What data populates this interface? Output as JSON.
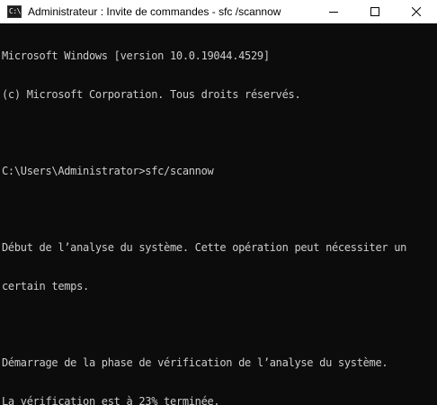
{
  "window": {
    "title": "Administrateur : Invite de commandes - sfc /scannow",
    "icon": "cmd-icon",
    "icon_glyph": "C:\\.",
    "controls": {
      "minimize": "minimize-icon",
      "maximize": "maximize-icon",
      "close": "close-icon"
    }
  },
  "console": {
    "lines": [
      "Microsoft Windows [version 10.0.19044.4529]",
      "(c) Microsoft Corporation. Tous droits réservés.",
      "",
      "C:\\Users\\Administrator>sfc/scannow",
      "",
      "Début de l’analyse du système. Cette opération peut nécessiter un",
      "certain temps.",
      "",
      "Démarrage de la phase de vérification de l’analyse du système.",
      "La vérification est à 23% terminée."
    ],
    "progress_percent": 23
  },
  "colors": {
    "console_background": "#0c0c0c",
    "console_text": "#cccccc",
    "titlebar_background": "#ffffff"
  }
}
